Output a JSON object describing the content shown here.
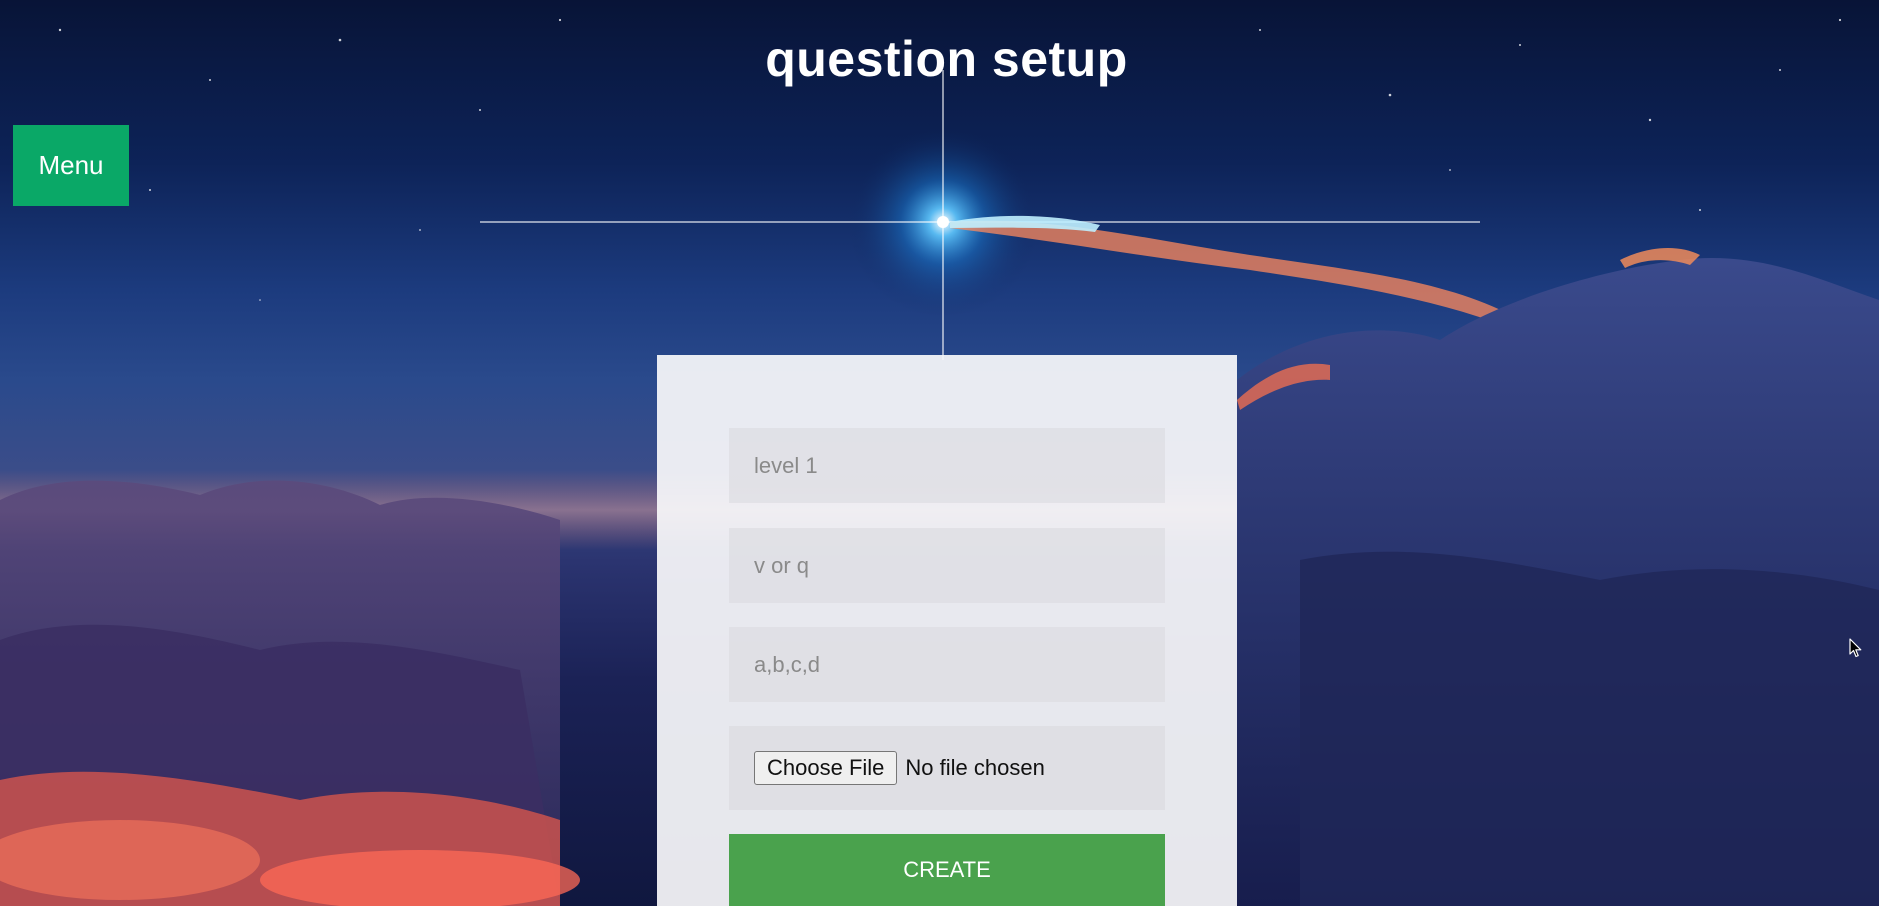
{
  "page": {
    "title": "question setup"
  },
  "menu": {
    "label": "Menu"
  },
  "form": {
    "level_placeholder": "level 1",
    "type_placeholder": "v or q",
    "answers_placeholder": "a,b,c,d",
    "file_button_label": "Choose File",
    "file_status": "No file chosen",
    "submit_label": "CREATE"
  },
  "colors": {
    "menu_button": "#0aa867",
    "create_button": "#4aa24d",
    "card_background": "#f8f8fa"
  },
  "icons": {
    "pointer": "mouse-pointer-icon"
  }
}
